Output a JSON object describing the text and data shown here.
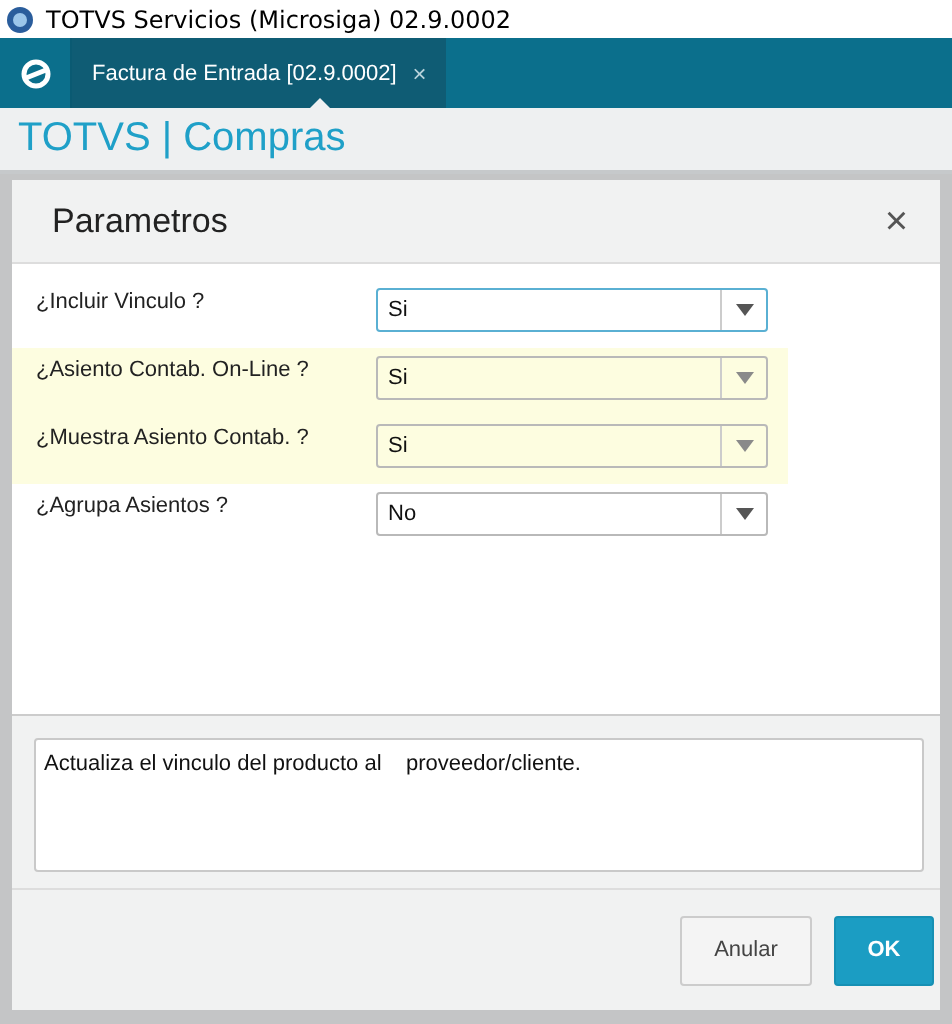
{
  "window": {
    "title": "TOTVS Servicios (Microsiga) 02.9.0002"
  },
  "tabs": [
    {
      "label": "Factura de Entrada [02.9.0002]",
      "close": "×",
      "selected": true
    }
  ],
  "header": {
    "title": "TOTVS | Compras"
  },
  "dialog": {
    "title": "Parametros",
    "close": "×",
    "fields": [
      {
        "label": "¿Incluir Vinculo ?",
        "value": "Si",
        "highlighted": false,
        "focused": true
      },
      {
        "label": "¿Asiento Contab. On-Line ?",
        "value": "Si",
        "highlighted": true,
        "focused": false
      },
      {
        "label": "¿Muestra Asiento Contab. ?",
        "value": "Si",
        "highlighted": true,
        "focused": false
      },
      {
        "label": "¿Agrupa Asientos ?",
        "value": "No",
        "highlighted": false,
        "focused": false
      }
    ],
    "description": "Actualiza el vinculo del producto al    proveedor/cliente.",
    "buttons": [
      {
        "label": "Anular",
        "kind": "secondary"
      },
      {
        "label": "OK",
        "kind": "primary"
      }
    ]
  }
}
